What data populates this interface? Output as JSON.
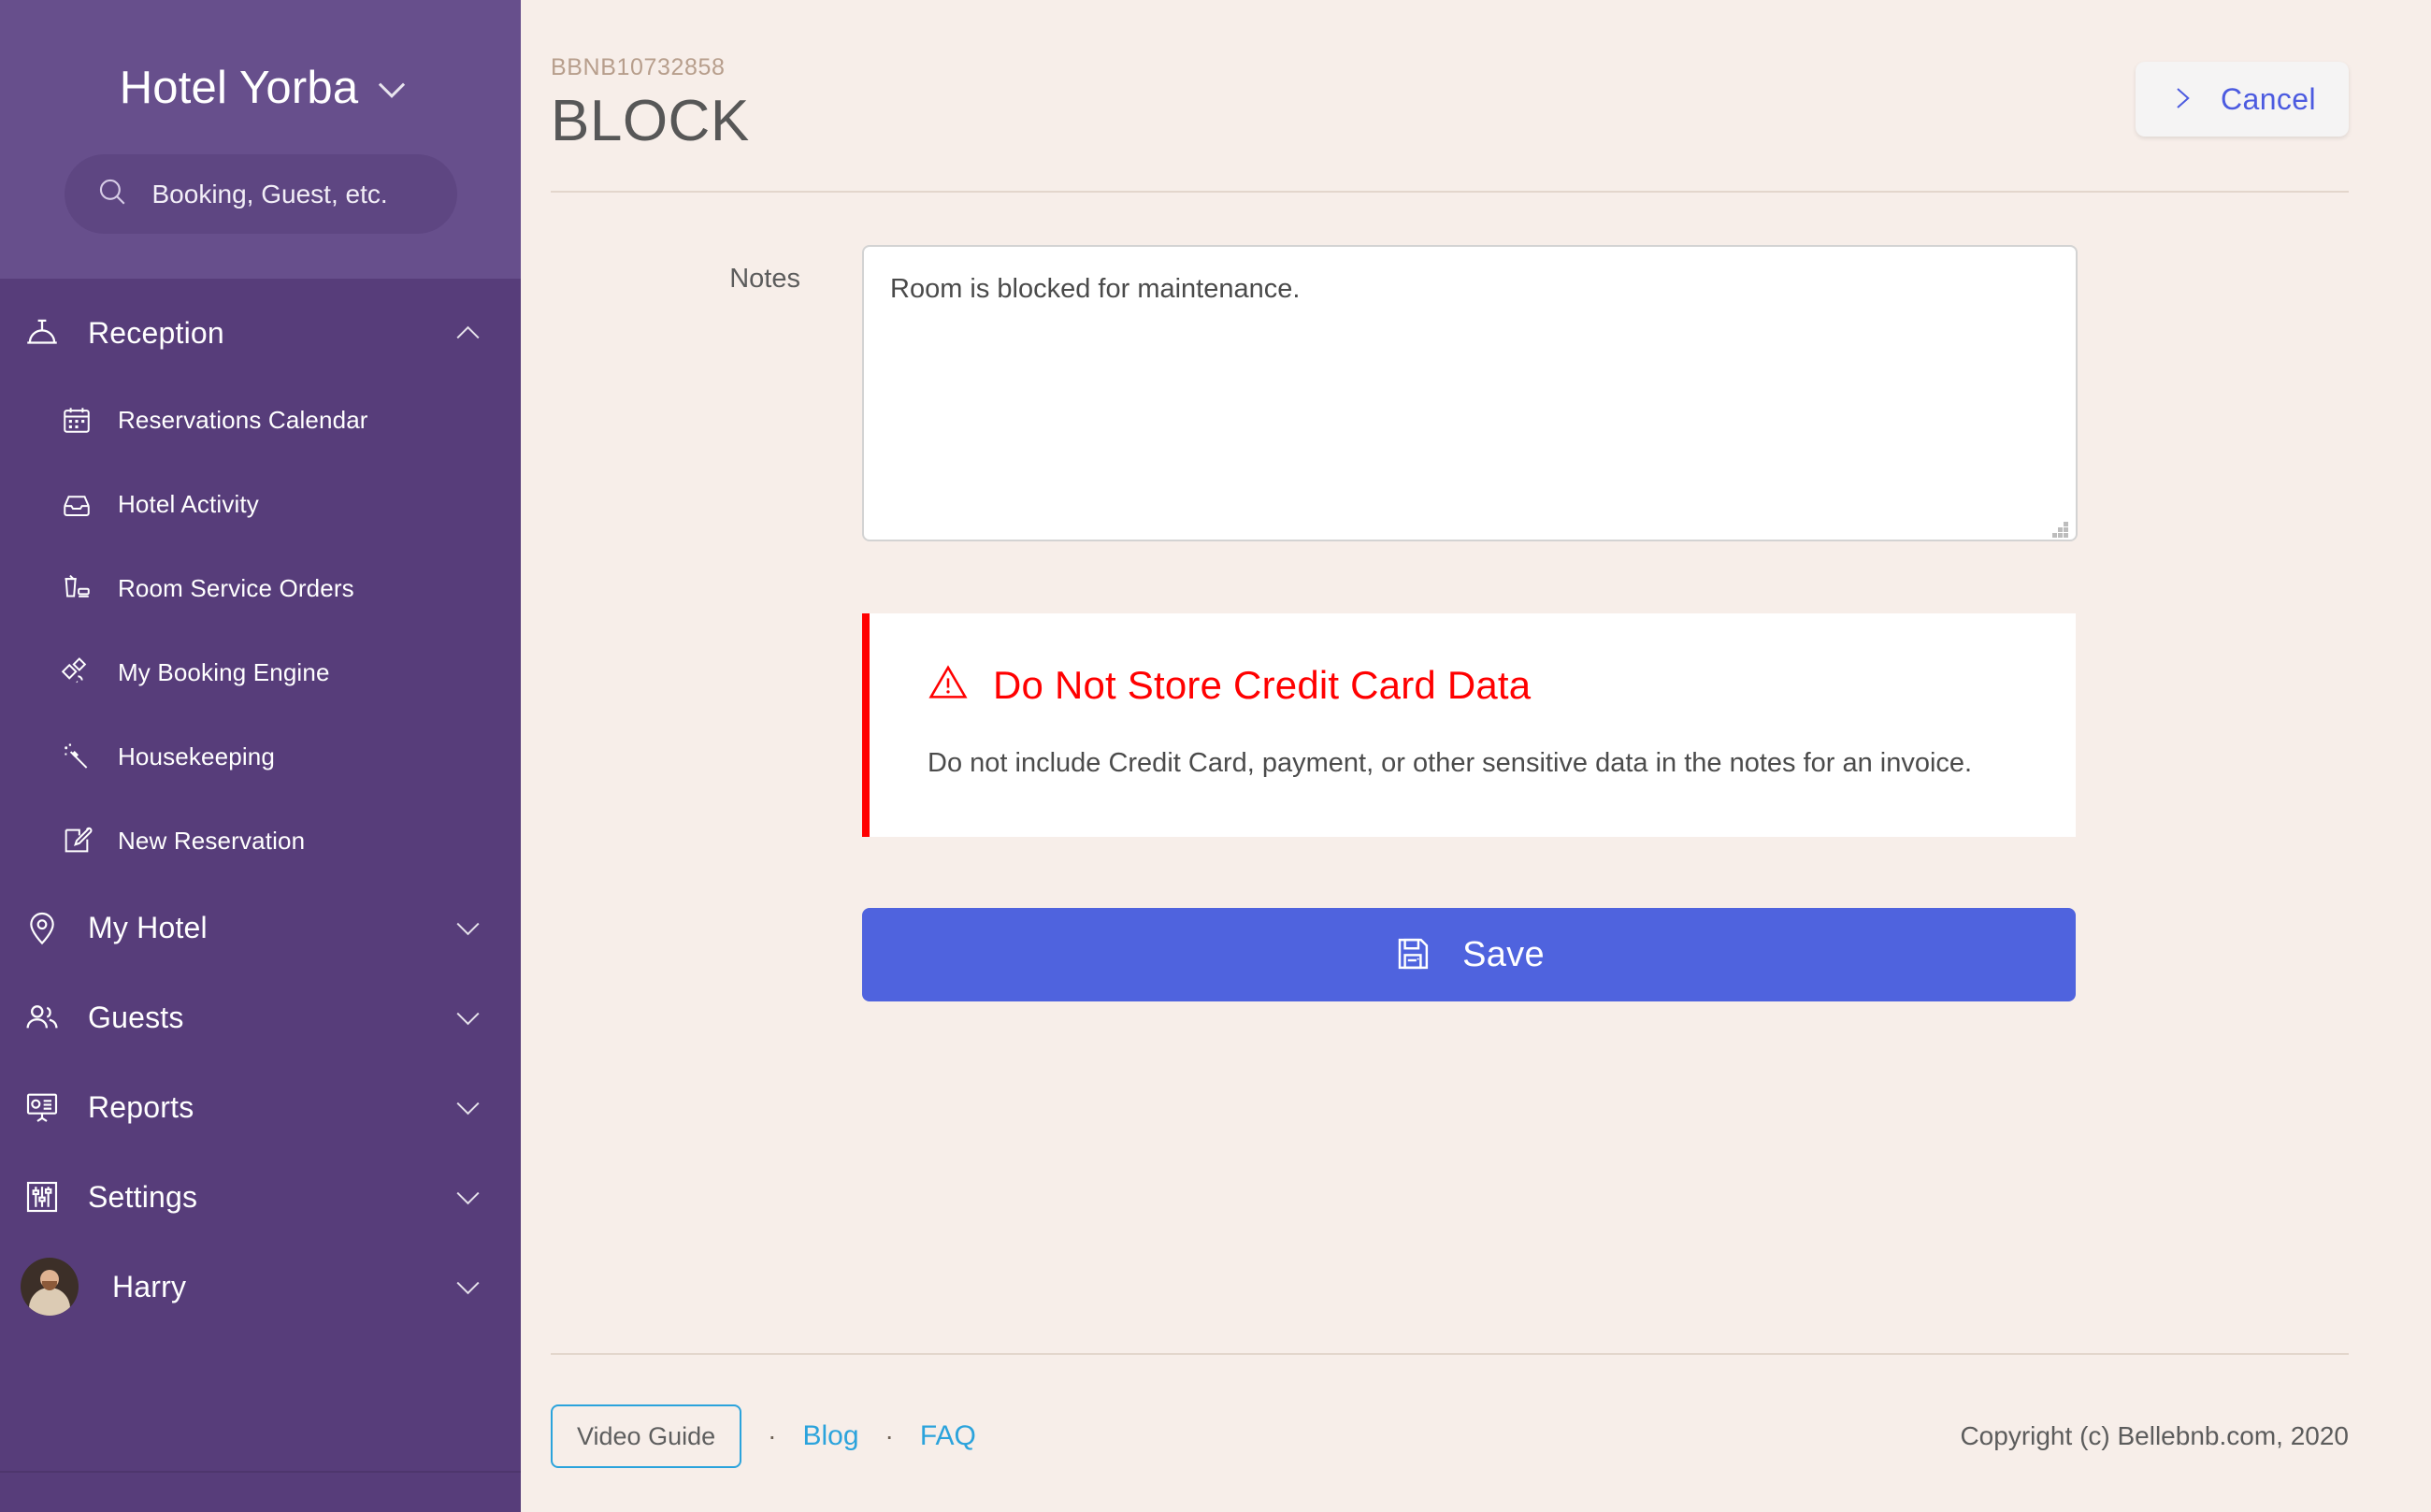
{
  "sidebar": {
    "brand": "Hotel Yorba",
    "brand_chevron_icon": "chevron-down-icon",
    "search": {
      "placeholder": "Booking, Guest, etc.",
      "icon": "search-icon"
    },
    "groups": [
      {
        "label": "Reception",
        "icon": "reception-bell-icon",
        "expanded": true,
        "chevron_icon": "chevron-up-icon",
        "items": [
          {
            "label": "Reservations Calendar",
            "icon": "calendar-icon"
          },
          {
            "label": "Hotel Activity",
            "icon": "inbox-icon"
          },
          {
            "label": "Room Service Orders",
            "icon": "room-service-icon"
          },
          {
            "label": "My Booking Engine",
            "icon": "satellite-icon"
          },
          {
            "label": "Housekeeping",
            "icon": "magic-wand-icon"
          },
          {
            "label": "New Reservation",
            "icon": "edit-square-icon"
          }
        ]
      },
      {
        "label": "My Hotel",
        "icon": "map-pin-icon",
        "expanded": false,
        "chevron_icon": "chevron-down-icon",
        "items": []
      },
      {
        "label": "Guests",
        "icon": "users-icon",
        "expanded": false,
        "chevron_icon": "chevron-down-icon",
        "items": []
      },
      {
        "label": "Reports",
        "icon": "presentation-chart-icon",
        "expanded": false,
        "chevron_icon": "chevron-down-icon",
        "items": []
      },
      {
        "label": "Settings",
        "icon": "sliders-icon",
        "expanded": false,
        "chevron_icon": "chevron-down-icon",
        "items": []
      }
    ],
    "user": {
      "name": "Harry",
      "avatar_icon": "user-avatar",
      "chevron_icon": "chevron-down-icon"
    }
  },
  "header": {
    "booking_code": "BBNB10732858",
    "title": "BLOCK",
    "cancel_label": "Cancel",
    "cancel_icon": "chevron-right-icon"
  },
  "form": {
    "notes_label": "Notes",
    "notes_value": "Room is blocked for maintenance."
  },
  "alert": {
    "icon": "warning-triangle-icon",
    "title": "Do Not Store Credit Card Data",
    "body": "Do not include Credit Card, payment, or other sensitive data in the notes for an invoice.",
    "accent_color": "#FF0000"
  },
  "save": {
    "label": "Save",
    "icon": "floppy-disk-save-icon",
    "color": "#4F63DE"
  },
  "footer": {
    "video_guide_label": "Video Guide",
    "separator": "·",
    "links": [
      {
        "label": "Blog"
      },
      {
        "label": "FAQ"
      }
    ],
    "copyright": "Copyright (c) Bellebnb.com, 2020",
    "link_color": "#2BA3DC"
  },
  "colors": {
    "sidebar_top": "#674F8C",
    "sidebar_nav": "#573D7A",
    "page_background": "#F7EEE9",
    "accent_blue": "#4C5BE0"
  }
}
